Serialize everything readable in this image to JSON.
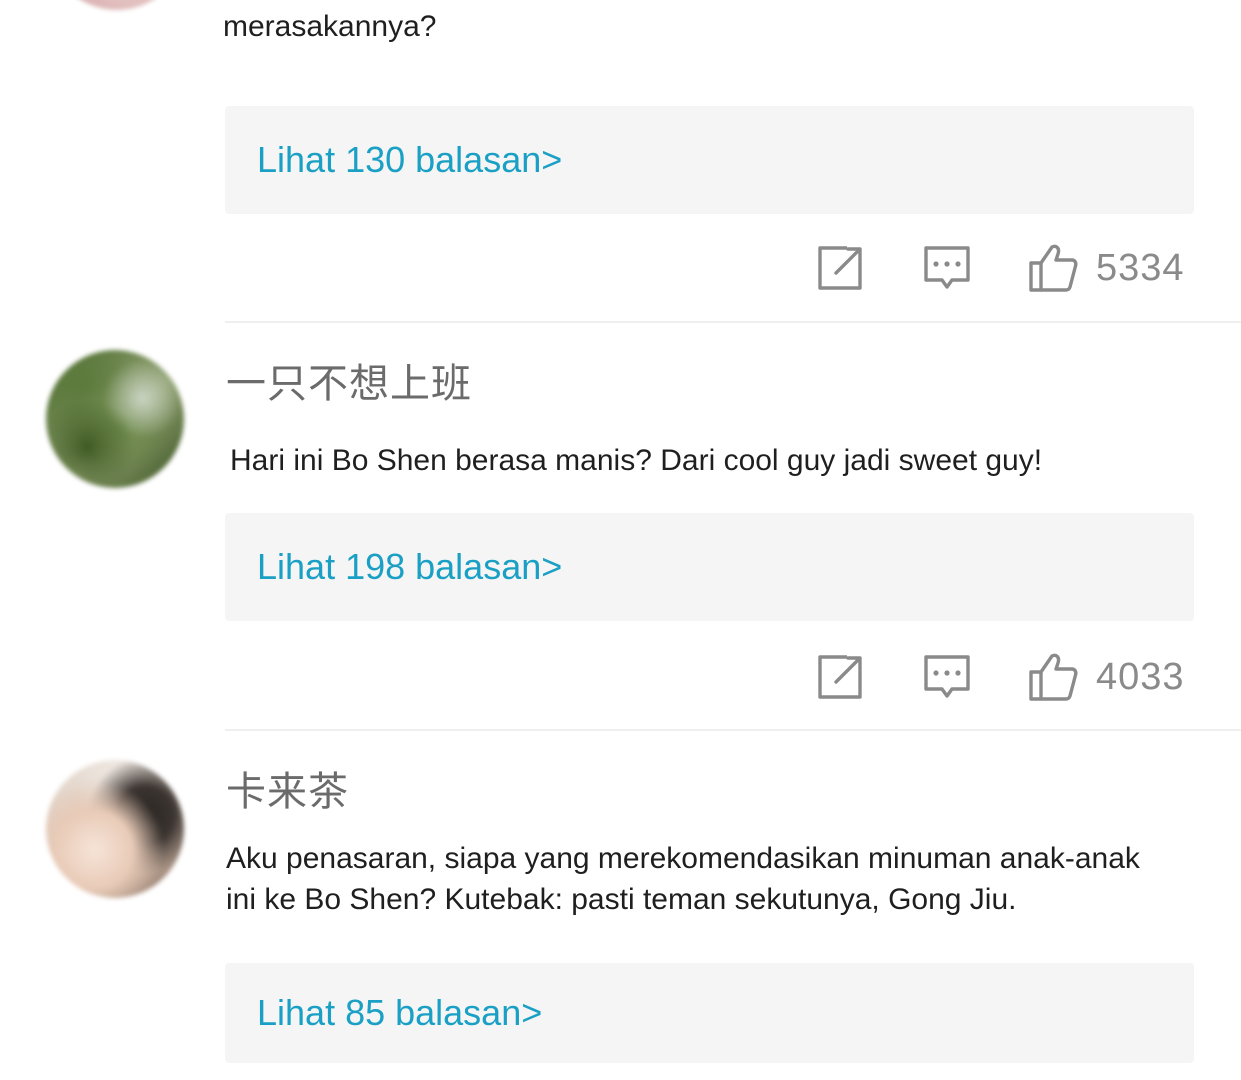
{
  "comments": [
    {
      "username": "",
      "text_lines": [
        "merasakannya?"
      ],
      "replies_label": "Lihat 130 balasan>",
      "like_count": "5334"
    },
    {
      "username": "一只不想上班",
      "text_lines": [
        "Hari ini Bo Shen berasa manis? Dari cool guy jadi sweet guy!"
      ],
      "replies_label": "Lihat 198 balasan>",
      "like_count": "4033"
    },
    {
      "username": "卡来茶",
      "text_lines": [
        "Aku penasaran, siapa yang merekomendasikan minuman anak-anak",
        "ini ke Bo Shen? Kutebak: pasti teman sekutunya, Gong Jiu."
      ],
      "replies_label": "Lihat 85 balasan>"
    }
  ],
  "icons": {
    "share": "share-icon",
    "reply": "comment-icon",
    "like": "thumbs-up-icon"
  },
  "colors": {
    "link": "#1aa0c4",
    "reply_box_bg": "#f5f5f5",
    "icon_gray": "#8a8a8a",
    "username_gray": "#6b6b6b"
  }
}
